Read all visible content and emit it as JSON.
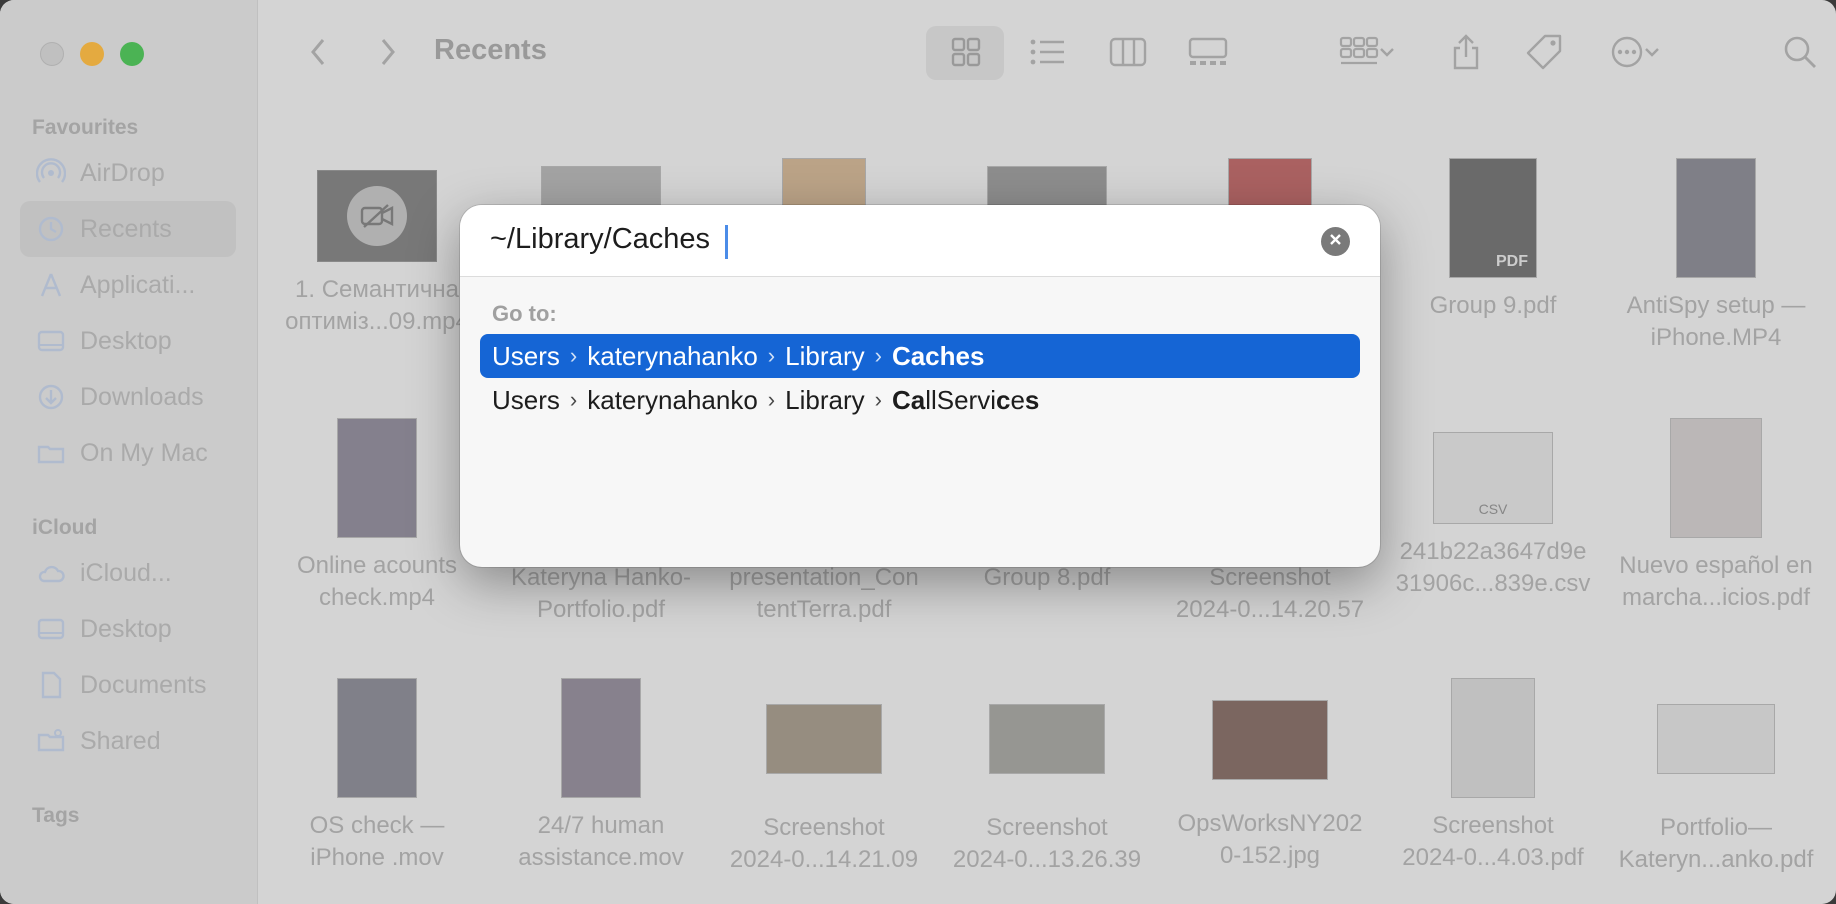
{
  "window": {
    "title": "Recents"
  },
  "sidebar": {
    "favourites_heading": "Favourites",
    "favourites": [
      {
        "label": "AirDrop",
        "icon": "airdrop-icon"
      },
      {
        "label": "Recents",
        "icon": "clock-icon",
        "selected": true
      },
      {
        "label": "Applicati...",
        "icon": "applications-icon"
      },
      {
        "label": "Desktop",
        "icon": "desktop-icon"
      },
      {
        "label": "Downloads",
        "icon": "downloads-icon"
      },
      {
        "label": "On My Mac",
        "icon": "folder-icon"
      }
    ],
    "icloud_heading": "iCloud",
    "icloud": [
      {
        "label": "iCloud...",
        "icon": "cloud-icon"
      },
      {
        "label": "Desktop",
        "icon": "desktop-icon"
      },
      {
        "label": "Documents",
        "icon": "document-icon"
      },
      {
        "label": "Shared",
        "icon": "shared-folder-icon"
      }
    ],
    "tags_heading": "Tags"
  },
  "files": [
    {
      "line1": "1. Семантична",
      "line2": "оптиміз...09.mp4"
    },
    {
      "line1": "",
      "line2": ""
    },
    {
      "line1": "",
      "line2": ""
    },
    {
      "line1": "",
      "line2": ""
    },
    {
      "line1": "",
      "line2": ""
    },
    {
      "line1": "Group 9.pdf",
      "line2": ""
    },
    {
      "line1": "AntiSpy setup —",
      "line2": "iPhone.MP4"
    },
    {
      "line1": "Online acounts",
      "line2": "check.mp4"
    },
    {
      "line1": "Kateryna Hanko-",
      "line2": "Portfolio.pdf"
    },
    {
      "line1": "presentation_Con",
      "line2": "tentTerra.pdf"
    },
    {
      "line1": "Group 8.pdf",
      "line2": ""
    },
    {
      "line1": "Screenshot",
      "line2": "2024-0...14.20.57"
    },
    {
      "line1": "241b22a3647d9e",
      "line2": "31906c...839e.csv"
    },
    {
      "line1": "Nuevo español en",
      "line2": "marcha...icios.pdf"
    },
    {
      "line1": "OS check —",
      "line2": "iPhone .mov"
    },
    {
      "line1": "24/7 human",
      "line2": "assistance.mov"
    },
    {
      "line1": "Screenshot",
      "line2": "2024-0...14.21.09"
    },
    {
      "line1": "Screenshot",
      "line2": "2024-0...13.26.39"
    },
    {
      "line1": "OpsWorksNY202",
      "line2": "0-152.jpg"
    },
    {
      "line1": "Screenshot",
      "line2": "2024-0...4.03.pdf"
    },
    {
      "line1": "Portfolio—",
      "line2": "Kateryn...anko.pdf"
    }
  ],
  "thumb_labels": {
    "pdf": "PDF",
    "csv": "CSV"
  },
  "dialog": {
    "path_value": "~/Library/Caches",
    "goto_label": "Go to:",
    "suggestions": [
      {
        "parts": [
          "Users",
          "katerynahanko",
          "Library"
        ],
        "last_bold": "Caches",
        "last_rest": "",
        "active": true
      },
      {
        "parts": [
          "Users",
          "katerynahanko",
          "Library"
        ],
        "last_segments": [
          [
            "Ca",
            true
          ],
          [
            "llServi",
            false
          ],
          [
            "c",
            true
          ],
          [
            "e",
            false
          ],
          [
            "s",
            true
          ]
        ],
        "active": false
      }
    ]
  },
  "colors": {
    "accent": "#1565d5",
    "traffic_min": "#e9a321",
    "traffic_max": "#2fae3a"
  }
}
